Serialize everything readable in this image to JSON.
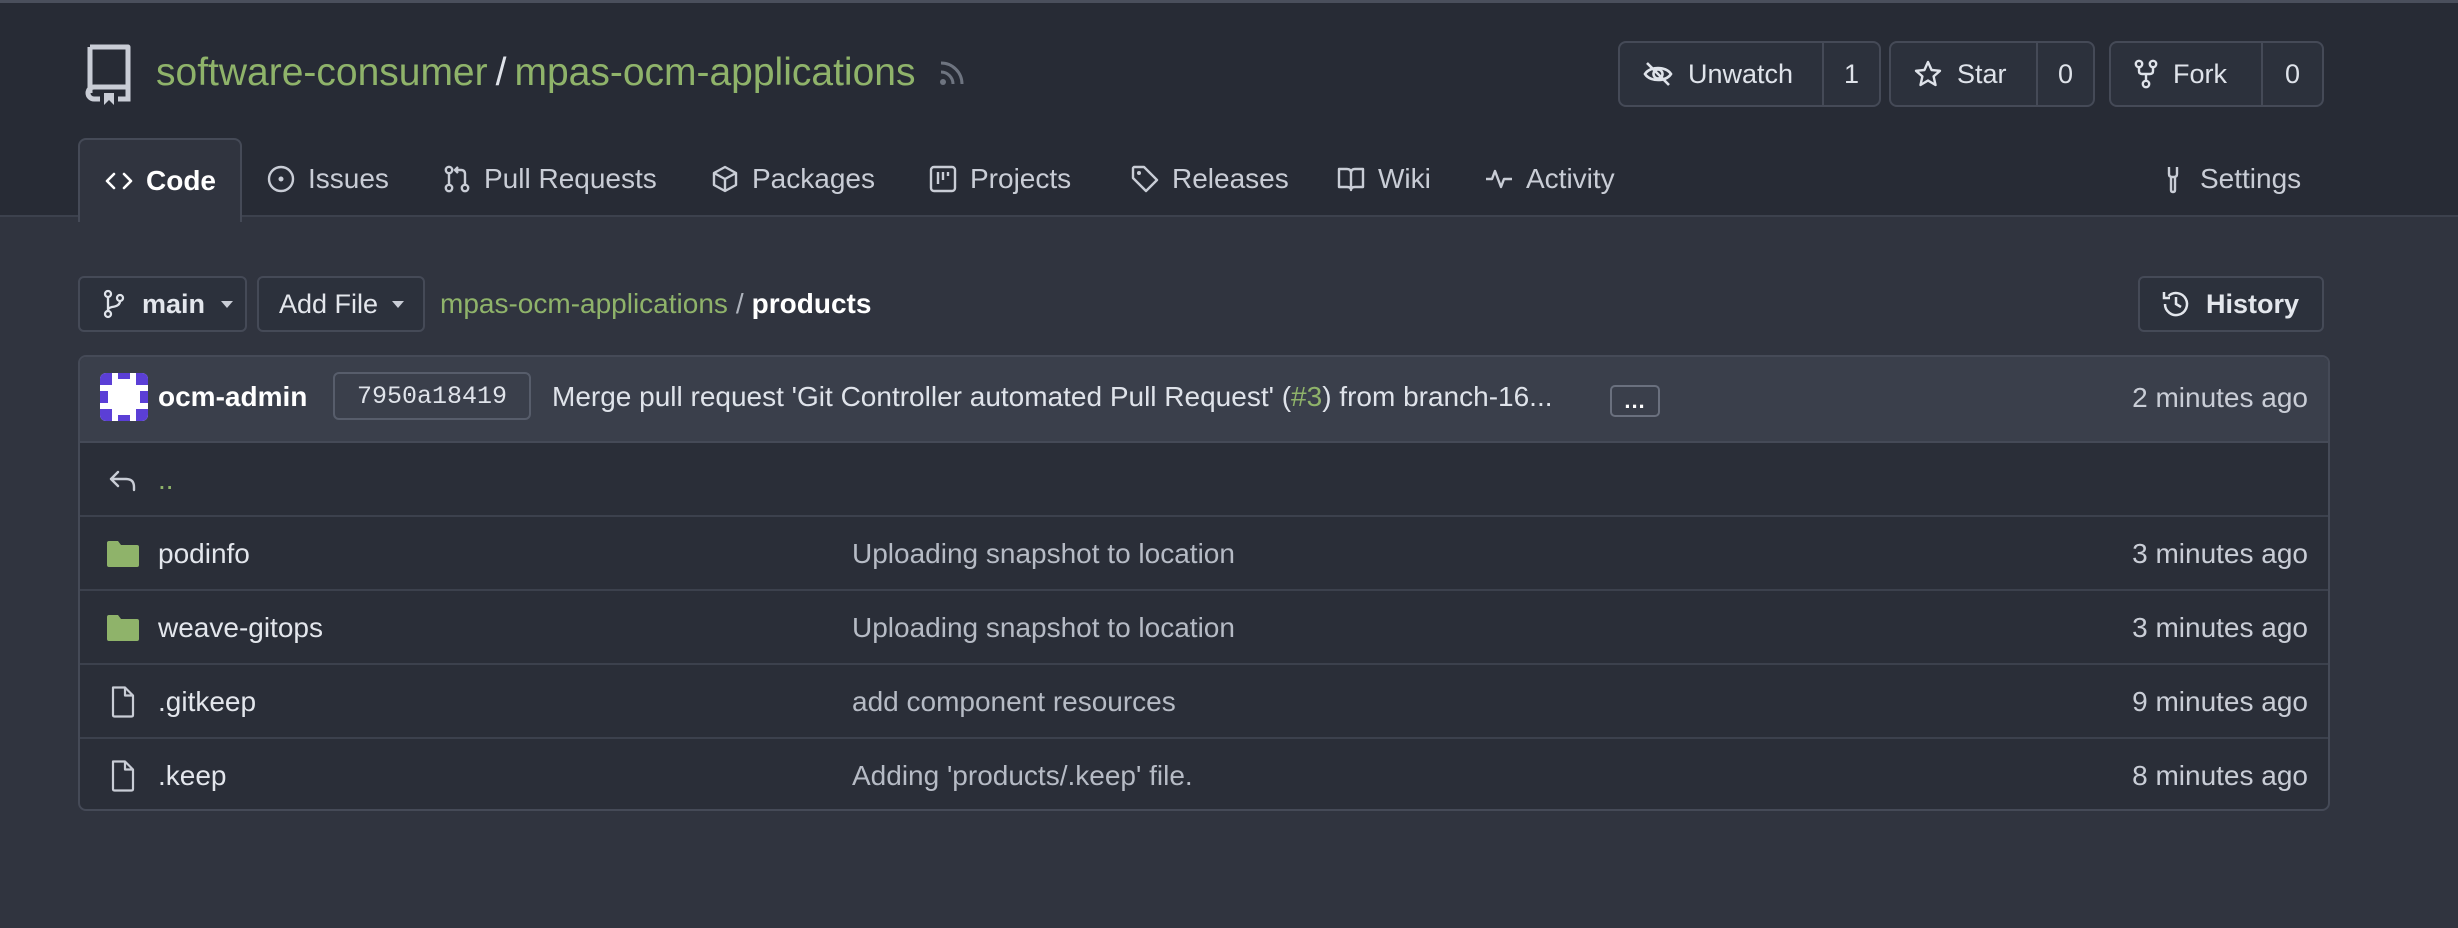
{
  "repo": {
    "owner": "software-consumer",
    "separator": "/",
    "name": "mpas-ocm-applications",
    "icons": {
      "repo": "repo-icon",
      "rss": "rss-icon"
    }
  },
  "actions": {
    "watch": {
      "label": "Unwatch",
      "count": "1",
      "icon": "eye-slash-icon"
    },
    "star": {
      "label": "Star",
      "count": "0",
      "icon": "star-icon"
    },
    "fork": {
      "label": "Fork",
      "count": "0",
      "icon": "fork-icon"
    }
  },
  "tabs": [
    {
      "label": "Code",
      "icon": "code-icon",
      "active": true
    },
    {
      "label": "Issues",
      "icon": "issue-icon"
    },
    {
      "label": "Pull Requests",
      "icon": "pull-request-icon"
    },
    {
      "label": "Packages",
      "icon": "package-icon"
    },
    {
      "label": "Projects",
      "icon": "project-icon"
    },
    {
      "label": "Releases",
      "icon": "tag-icon"
    },
    {
      "label": "Wiki",
      "icon": "book-icon"
    },
    {
      "label": "Activity",
      "icon": "pulse-icon"
    },
    {
      "label": "Settings",
      "icon": "wrench-icon"
    }
  ],
  "toolbar": {
    "branch": "main",
    "add_file": "Add File",
    "history": "History"
  },
  "breadcrumb": {
    "repo": "mpas-ocm-applications",
    "separator": "/",
    "current": "products"
  },
  "commit": {
    "author": "ocm-admin",
    "sha": "7950a18419",
    "message_prefix": "Merge pull request 'Git Controller automated Pull Request' (",
    "pr_link": "#3",
    "message_suffix": ") from branch-16...",
    "more": "...",
    "time": "2 minutes ago"
  },
  "parent_dir": "..",
  "files": [
    {
      "name": "podinfo",
      "type": "folder",
      "message": "Uploading snapshot to location",
      "time": "3 minutes ago"
    },
    {
      "name": "weave-gitops",
      "type": "folder",
      "message": "Uploading snapshot to location",
      "time": "3 minutes ago"
    },
    {
      "name": ".gitkeep",
      "type": "file",
      "message": "add component resources",
      "time": "9 minutes ago"
    },
    {
      "name": ".keep",
      "type": "file",
      "message": "Adding 'products/.keep' file.",
      "time": "8 minutes ago"
    }
  ],
  "colors": {
    "link_green": "#8fb36a",
    "folder_green": "#8fb36a",
    "header_bg": "#272b35",
    "page_bg": "#30343f"
  }
}
